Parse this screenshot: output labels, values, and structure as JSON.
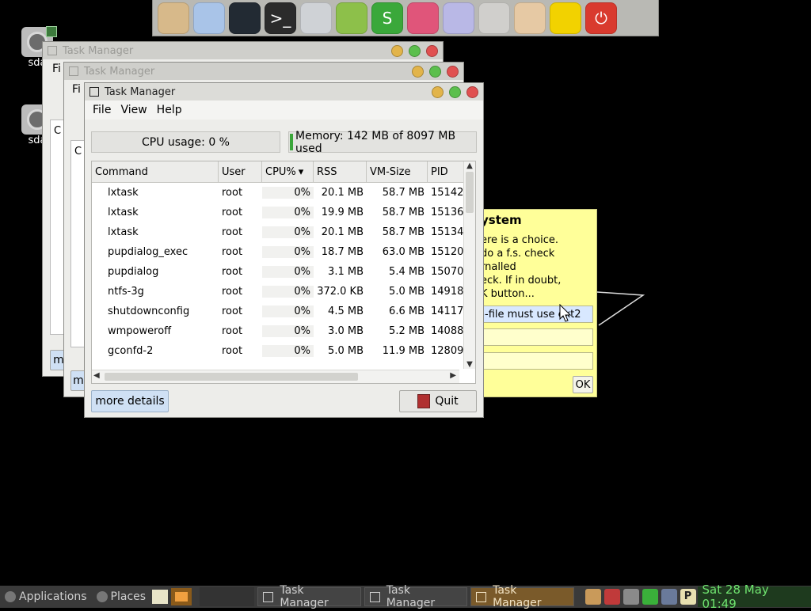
{
  "dock": {
    "icons": [
      {
        "name": "home-folder-icon",
        "color": "#d7b98a"
      },
      {
        "name": "cloud-icon",
        "color": "#a9c4e8"
      },
      {
        "name": "chat-icon",
        "color": "#222a33"
      },
      {
        "name": "terminal-icon",
        "color": "#2b2b2b",
        "glyph": ">_"
      },
      {
        "name": "monitor-icon",
        "color": "#cfd2d6"
      },
      {
        "name": "document-editor-icon",
        "color": "#8dc04a"
      },
      {
        "name": "spreadsheet-icon",
        "color": "#3aa83a",
        "glyph": "S"
      },
      {
        "name": "color-wheel-icon",
        "color": "#e0557a"
      },
      {
        "name": "text-file-icon",
        "color": "#b9b8e6"
      },
      {
        "name": "settings-sliders-icon",
        "color": "#d0cfcc"
      },
      {
        "name": "files-icon",
        "color": "#e6c9a4"
      },
      {
        "name": "volume-icon",
        "color": "#f2d200"
      },
      {
        "name": "power-icon",
        "color": "#d93a2e",
        "glyph": "⏻"
      }
    ]
  },
  "desktop": {
    "drives": [
      {
        "label": "sda"
      },
      {
        "label": "sda"
      }
    ]
  },
  "windows": {
    "back_title": "Task Manager",
    "middle_title": "Task Manager",
    "back_menu_fragment": "Fi",
    "middle_menu_fragment": "Fi",
    "back_col_fragment": "C",
    "middle_col_fragment": "C",
    "back_btn_fragment": "m",
    "middle_btn_fragment": "m"
  },
  "taskmanager": {
    "title": "Task Manager",
    "menu": [
      {
        "label": "File"
      },
      {
        "label": "View"
      },
      {
        "label": "Help"
      }
    ],
    "cpu_usage": "CPU usage: 0 %",
    "memory_usage": "Memory: 142 MB of 8097 MB used",
    "columns": [
      "Command",
      "User",
      "CPU%",
      "RSS",
      "VM-Size",
      "PID"
    ],
    "sort_indicator": "▾",
    "rows": [
      {
        "cmd": "lxtask",
        "user": "root",
        "cpu": "0%",
        "rss": "20.1 MB",
        "vm": "58.7 MB",
        "pid": "15142"
      },
      {
        "cmd": "lxtask",
        "user": "root",
        "cpu": "0%",
        "rss": "19.9 MB",
        "vm": "58.7 MB",
        "pid": "15136"
      },
      {
        "cmd": "lxtask",
        "user": "root",
        "cpu": "0%",
        "rss": "20.1 MB",
        "vm": "58.7 MB",
        "pid": "15134"
      },
      {
        "cmd": "pupdialog_exec",
        "user": "root",
        "cpu": "0%",
        "rss": "18.7 MB",
        "vm": "63.0 MB",
        "pid": "15120"
      },
      {
        "cmd": "pupdialog",
        "user": "root",
        "cpu": "0%",
        "rss": "3.1 MB",
        "vm": "5.4 MB",
        "pid": "15070"
      },
      {
        "cmd": "ntfs-3g",
        "user": "root",
        "cpu": "0%",
        "rss": "372.0 KB",
        "vm": "5.0 MB",
        "pid": "14918"
      },
      {
        "cmd": "shutdownconfig",
        "user": "root",
        "cpu": "0%",
        "rss": "4.5 MB",
        "vm": "6.6 MB",
        "pid": "14117"
      },
      {
        "cmd": "wmpoweroff",
        "user": "root",
        "cpu": "0%",
        "rss": "3.0 MB",
        "vm": "5.2 MB",
        "pid": "14088"
      },
      {
        "cmd": "gconfd-2",
        "user": "root",
        "cpu": "0%",
        "rss": "5.0 MB",
        "vm": "11.9 MB",
        "pid": "12809"
      }
    ],
    "more_details_label": "more details",
    "quit_label": "Quit"
  },
  "yellow_dialog": {
    "title": "ystem",
    "text_lines": [
      "ere is a choice.",
      "do a f.s. check",
      "rnalled",
      "eck. If in doubt,",
      "K button..."
    ],
    "field_value": "-file must use ext2",
    "ok_label": "OK"
  },
  "taskbar": {
    "applications_label": "Applications",
    "places_label": "Places",
    "tasks": [
      {
        "label": "Task Manager",
        "active": false
      },
      {
        "label": "Task Manager",
        "active": false
      },
      {
        "label": "Task Manager",
        "active": true
      }
    ],
    "clock": "Sat 28 May 01:49"
  }
}
